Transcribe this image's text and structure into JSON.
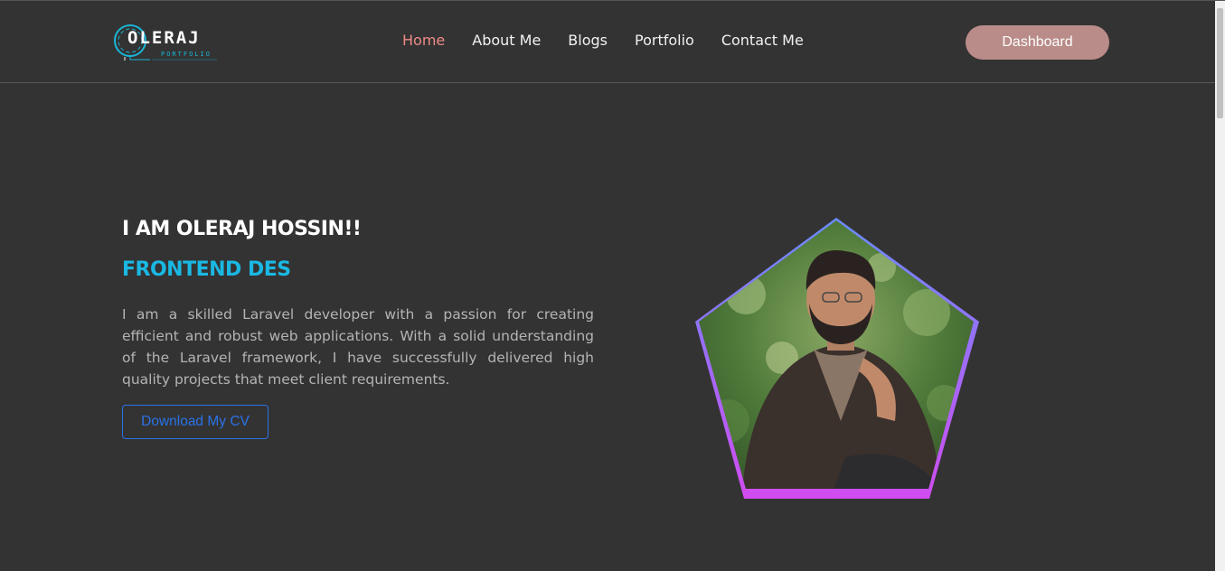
{
  "brand": {
    "logo_text": "OLERAJ",
    "logo_subtext": "PORTFOLIO"
  },
  "nav": {
    "items": [
      {
        "label": "Home",
        "active": true
      },
      {
        "label": "About Me",
        "active": false
      },
      {
        "label": "Blogs",
        "active": false
      },
      {
        "label": "Portfolio",
        "active": false
      },
      {
        "label": "Contact Me",
        "active": false
      }
    ],
    "dashboard_label": "Dashboard"
  },
  "hero": {
    "title": "I AM OLERAJ HOSSIN!!",
    "subtitle": "FRONTEND DES",
    "description": "I am a skilled Laravel developer with a passion for creating efficient and robust web applications. With a solid understanding of the Laravel framework, I have successfully delivered high quality projects that meet client requirements.",
    "cv_button_label": "Download My CV"
  },
  "colors": {
    "background": "#333333",
    "active_nav": "#ee8a86",
    "dashboard_button": "#b98c89",
    "subtitle_accent": "#1ab8e3",
    "cv_button": "#2a73e8",
    "pentagon_border_start": "#5b8cff",
    "pentagon_border_end": "#d14cf0"
  },
  "icons": {
    "logo": "circuit-ring-logo-icon",
    "portrait": "pentagon-profile-photo"
  }
}
